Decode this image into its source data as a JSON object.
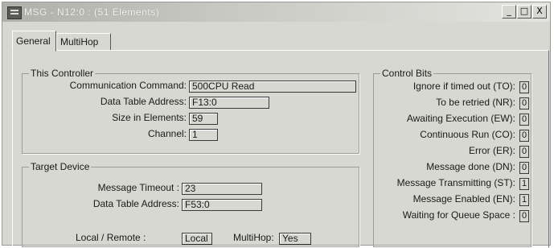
{
  "window": {
    "title": "MSG - N12:0 : (51 Elements)",
    "btn_min": "_",
    "btn_max": "□",
    "btn_close": "X"
  },
  "tabs": [
    {
      "label": "General"
    },
    {
      "label": "MultiHop"
    }
  ],
  "this_controller": {
    "title": "This Controller",
    "comm_label": "Communication Command:",
    "comm_value": "500CPU Read",
    "dta_label": "Data Table Address:",
    "dta_value": "F13:0",
    "size_label": "Size in Elements:",
    "size_value": "59",
    "channel_label": "Channel:",
    "channel_value": "1"
  },
  "target_device": {
    "title": "Target Device",
    "timeout_label": "Message Timeout :",
    "timeout_value": "23",
    "dta_label": "Data Table Address:",
    "dta_value": "F53:0",
    "local_remote_label": "Local / Remote :",
    "local_remote_value": "Local",
    "multihop_label": "MultiHop:",
    "multihop_value": "Yes"
  },
  "control_bits": {
    "title": "Control Bits",
    "items": [
      {
        "label": "Ignore if timed out (TO):",
        "value": "0"
      },
      {
        "label": "To be retried (NR):",
        "value": "0"
      },
      {
        "label": "Awaiting Execution (EW):",
        "value": "0"
      },
      {
        "label": "Continuous Run (CO):",
        "value": "0"
      },
      {
        "label": "Error (ER):",
        "value": "0"
      },
      {
        "label": "Message done (DN):",
        "value": "0"
      },
      {
        "label": "Message Transmitting (ST):",
        "value": "1"
      },
      {
        "label": "Message Enabled (EN):",
        "value": "1"
      },
      {
        "label": "Waiting for Queue Space :",
        "value": "0"
      }
    ]
  }
}
